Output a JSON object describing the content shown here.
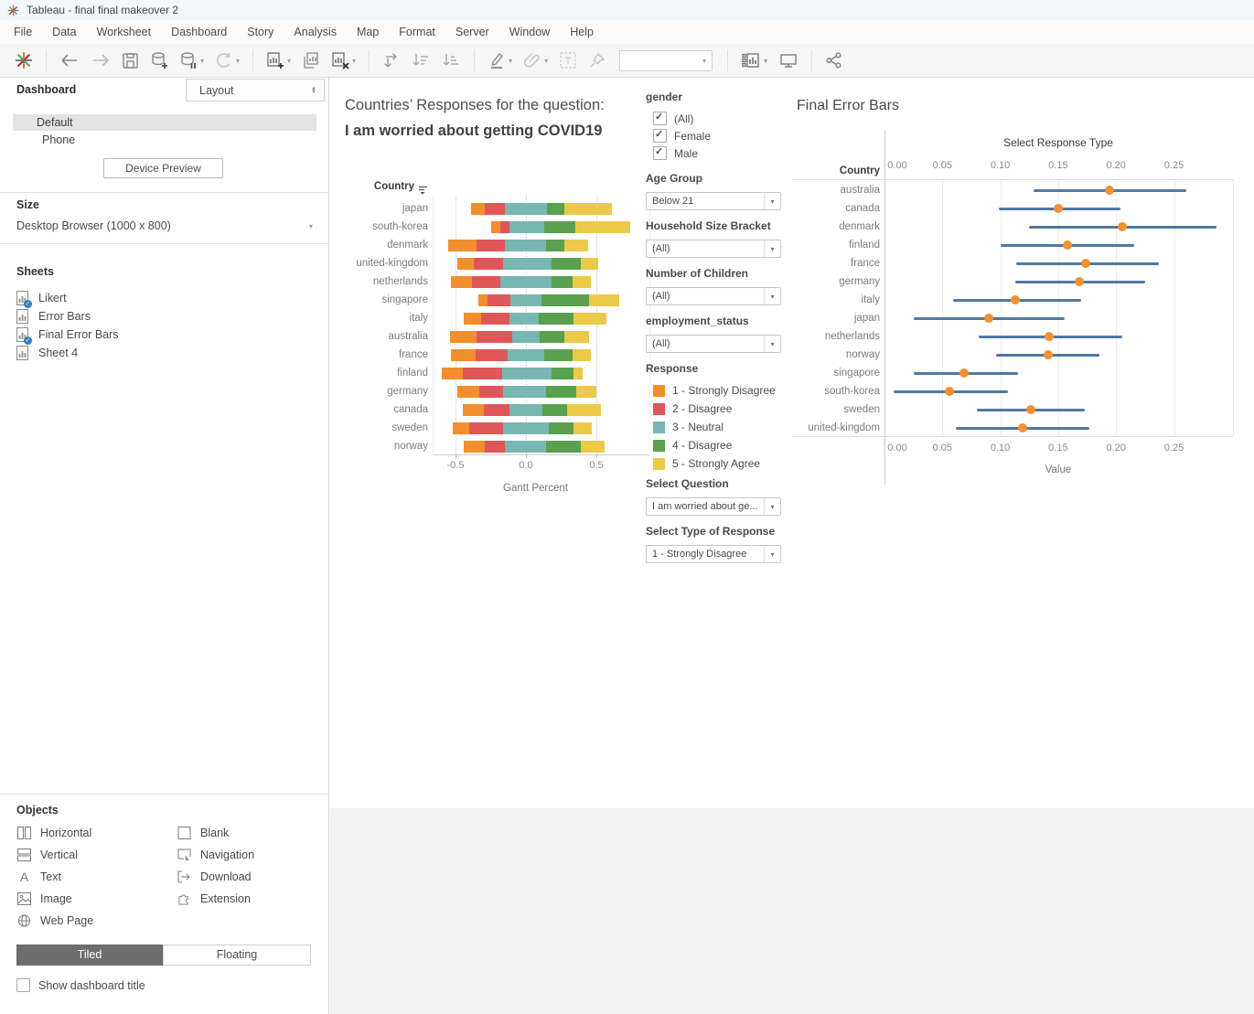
{
  "window": {
    "title": "Tableau - final final makeover 2"
  },
  "menu": [
    "File",
    "Data",
    "Worksheet",
    "Dashboard",
    "Story",
    "Analysis",
    "Map",
    "Format",
    "Server",
    "Window",
    "Help"
  ],
  "toolbar": {
    "fit_value": "",
    "icons": [
      "tableau-logo",
      "undo",
      "redo",
      "save",
      "add-data",
      "pause-auto-updates",
      "refresh",
      "new-worksheet",
      "duplicate-sheet",
      "clear-sheet",
      "swap-axes",
      "sort-ascending",
      "sort-descending",
      "highlight",
      "format-copy",
      "text-label",
      "pin",
      "fit-selector",
      "show-me",
      "presentation-mode",
      "share"
    ]
  },
  "sidebar": {
    "tab_dashboard": "Dashboard",
    "tab_layout": "Layout",
    "devices": [
      "Default",
      "Phone"
    ],
    "selected_device": "Default",
    "device_preview": "Device Preview",
    "size_header": "Size",
    "size_value": "Desktop Browser (1000 x 800)",
    "sheets_header": "Sheets",
    "sheets": [
      {
        "label": "Likert",
        "used": true
      },
      {
        "label": "Error Bars",
        "used": false
      },
      {
        "label": "Final Error Bars",
        "used": true
      },
      {
        "label": "Sheet 4",
        "used": false
      }
    ],
    "objects_header": "Objects",
    "objects_left": [
      "Horizontal",
      "Vertical",
      "Text",
      "Image",
      "Web Page"
    ],
    "objects_right": [
      "Blank",
      "Navigation",
      "Download",
      "Extension"
    ],
    "tiled": "Tiled",
    "floating": "Floating",
    "show_dashboard_title": "Show dashboard title",
    "show_dashboard_title_checked": false
  },
  "filters": {
    "gender": {
      "header": "gender",
      "options": [
        {
          "label": "(All)",
          "checked": true
        },
        {
          "label": "Female",
          "checked": true
        },
        {
          "label": "Male",
          "checked": true
        }
      ]
    },
    "age_group": {
      "header": "Age Group",
      "value": "Below 21"
    },
    "household": {
      "header": "Household Size Bracket",
      "value": "(All)"
    },
    "children": {
      "header": "Number of Children",
      "value": "(All)"
    },
    "employment": {
      "header": "employment_status",
      "value": "(All)"
    },
    "response_legend": {
      "header": "Response",
      "items": [
        {
          "label": "1 - Strongly Disagree",
          "color": "#f28e2b"
        },
        {
          "label": "2 - Disagree",
          "color": "#e15759"
        },
        {
          "label": "3 - Neutral",
          "color": "#76b7b2"
        },
        {
          "label": "4 - Disagree",
          "color": "#59a14f"
        },
        {
          "label": "5 - Strongly Agree",
          "color": "#edc948"
        }
      ]
    },
    "select_question": {
      "header": "Select Question",
      "value": "I am worried about ge..."
    },
    "select_response": {
      "header": "Select Type of Response",
      "value": "1 - Strongly Disagree"
    }
  },
  "chart_data": [
    {
      "type": "bar",
      "variant": "diverging_stacked_likert",
      "title_regular": "Countries’ Responses for the question: ",
      "title_bold": "I am worried about getting COVID19",
      "row_axis_header": "Country",
      "xlabel": "Gantt Percent",
      "x_ticks": [
        -0.5,
        0.0,
        0.5
      ],
      "x_tick_labels": [
        "-0.5",
        "0.0",
        "0.5"
      ],
      "xlim": [
        -0.66,
        0.88
      ],
      "grid": true,
      "series_order": [
        "1 - Strongly Disagree",
        "2 - Disagree",
        "3 - Neutral",
        "4 - Disagree",
        "5 - Strongly Agree"
      ],
      "series_colors": [
        "#f28e2b",
        "#e15759",
        "#76b7b2",
        "#59a14f",
        "#edc948"
      ],
      "rows": [
        {
          "country": "japan",
          "start": -0.39,
          "segments": [
            0.1,
            0.14,
            0.3,
            0.12,
            0.34
          ]
        },
        {
          "country": "south-korea",
          "start": -0.25,
          "segments": [
            0.07,
            0.06,
            0.25,
            0.22,
            0.39
          ]
        },
        {
          "country": "denmark",
          "start": -0.55,
          "segments": [
            0.2,
            0.2,
            0.29,
            0.13,
            0.17
          ]
        },
        {
          "country": "united-kingdom",
          "start": -0.49,
          "segments": [
            0.12,
            0.21,
            0.34,
            0.21,
            0.12
          ]
        },
        {
          "country": "netherlands",
          "start": -0.53,
          "segments": [
            0.15,
            0.2,
            0.36,
            0.15,
            0.13
          ]
        },
        {
          "country": "singapore",
          "start": -0.34,
          "segments": [
            0.07,
            0.16,
            0.22,
            0.34,
            0.21
          ]
        },
        {
          "country": "italy",
          "start": -0.44,
          "segments": [
            0.12,
            0.2,
            0.21,
            0.25,
            0.23
          ]
        },
        {
          "country": "australia",
          "start": -0.54,
          "segments": [
            0.19,
            0.25,
            0.2,
            0.17,
            0.18
          ]
        },
        {
          "country": "france",
          "start": -0.53,
          "segments": [
            0.17,
            0.23,
            0.26,
            0.2,
            0.13
          ]
        },
        {
          "country": "finland",
          "start": -0.6,
          "segments": [
            0.15,
            0.28,
            0.35,
            0.16,
            0.06
          ]
        },
        {
          "country": "germany",
          "start": -0.49,
          "segments": [
            0.16,
            0.17,
            0.3,
            0.22,
            0.14
          ]
        },
        {
          "country": "canada",
          "start": -0.45,
          "segments": [
            0.15,
            0.18,
            0.24,
            0.17,
            0.24
          ]
        },
        {
          "country": "sweden",
          "start": -0.52,
          "segments": [
            0.12,
            0.24,
            0.32,
            0.18,
            0.13
          ]
        },
        {
          "country": "norway",
          "start": -0.44,
          "segments": [
            0.15,
            0.14,
            0.29,
            0.25,
            0.17
          ]
        }
      ]
    },
    {
      "type": "scatter",
      "variant": "error_bars",
      "title": "Final Error Bars",
      "column_header": "Select Response Type",
      "row_axis_header": "Country",
      "xlabel": "Value",
      "x_ticks": [
        0.0,
        0.05,
        0.1,
        0.15,
        0.2,
        0.25
      ],
      "x_tick_labels": [
        "0.00",
        "0.05",
        "0.10",
        "0.15",
        "0.20",
        "0.25"
      ],
      "xlim": [
        0,
        0.3
      ],
      "grid": true,
      "bar_color": "#4e79a7",
      "dot_color": "#f5902e",
      "rows": [
        {
          "country": "australia",
          "low": 0.129,
          "value": 0.194,
          "high": 0.261
        },
        {
          "country": "canada",
          "low": 0.099,
          "value": 0.15,
          "high": 0.204
        },
        {
          "country": "denmark",
          "low": 0.125,
          "value": 0.205,
          "high": 0.287
        },
        {
          "country": "finland",
          "low": 0.1,
          "value": 0.158,
          "high": 0.216
        },
        {
          "country": "france",
          "low": 0.114,
          "value": 0.174,
          "high": 0.237
        },
        {
          "country": "germany",
          "low": 0.113,
          "value": 0.168,
          "high": 0.225
        },
        {
          "country": "italy",
          "low": 0.059,
          "value": 0.113,
          "high": 0.17
        },
        {
          "country": "japan",
          "low": 0.025,
          "value": 0.09,
          "high": 0.156
        },
        {
          "country": "netherlands",
          "low": 0.081,
          "value": 0.142,
          "high": 0.205
        },
        {
          "country": "norway",
          "low": 0.096,
          "value": 0.141,
          "high": 0.186
        },
        {
          "country": "singapore",
          "low": 0.025,
          "value": 0.069,
          "high": 0.115
        },
        {
          "country": "south-korea",
          "low": 0.008,
          "value": 0.056,
          "high": 0.107
        },
        {
          "country": "sweden",
          "low": 0.08,
          "value": 0.126,
          "high": 0.173
        },
        {
          "country": "united-kingdom",
          "low": 0.062,
          "value": 0.119,
          "high": 0.177
        }
      ]
    }
  ]
}
